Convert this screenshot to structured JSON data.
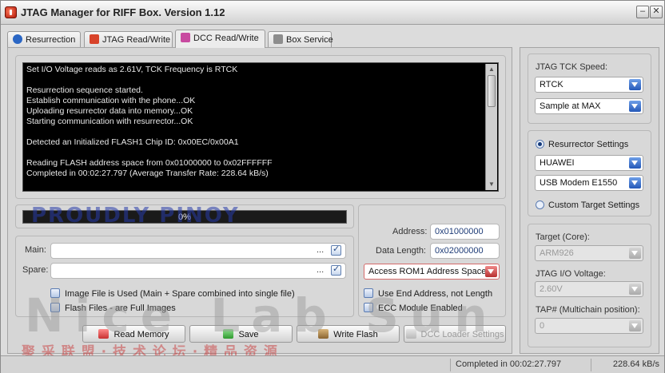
{
  "window": {
    "title": "JTAG Manager for RIFF Box. Version 1.12",
    "minimize_glyph": "–",
    "close_glyph": "✕"
  },
  "tabs": [
    {
      "label": "Resurrection",
      "icon": "info-icon",
      "color": "#2a66c4"
    },
    {
      "label": "JTAG Read/Write",
      "icon": "jtag-icon",
      "color": "#d8432a"
    },
    {
      "label": "DCC Read/Write",
      "icon": "dcc-icon",
      "color": "#c84aa0",
      "active": true
    },
    {
      "label": "Box Service",
      "icon": "box-icon",
      "color": "#8d8d8d"
    }
  ],
  "console": {
    "lines": [
      "Set I/O Voltage reads as 2.61V, TCK Frequency is RTCK",
      "",
      "Resurrection sequence started.",
      "Establish communication with the phone...OK",
      "Uploading resurrector data into memory...OK",
      "Starting communication with resurrector...OK",
      "",
      "Detected an Initialized FLASH1 Chip ID: 0x00EC/0x00A1",
      "",
      "Reading FLASH address space from 0x01000000 to 0x02FFFFFF",
      "Completed in 00:02:27.797 (Average Transfer Rate: 228.64 kB/s)"
    ]
  },
  "progress": {
    "text": "0%",
    "value": 0
  },
  "files": {
    "main_label": "Main:",
    "main_value": "",
    "main_dots": "...",
    "spare_label": "Spare:",
    "spare_value": "",
    "spare_dots": "...",
    "opt_image_file": "Image File is Used (Main + Spare combined into single file)",
    "opt_full_images": "Flash Files - are Full Images"
  },
  "address": {
    "address_label": "Address:",
    "address_value": "0x01000000",
    "length_label": "Data Length:",
    "length_value": "0x02000000",
    "access_selected": "Access ROM1 Address Space",
    "opt_end_address": "Use End Address, not Length",
    "opt_ecc": "ECC Module Enabled"
  },
  "buttons": {
    "read_memory": "Read Memory",
    "save": "Save",
    "write_flash": "Write Flash",
    "dcc_loader": "DCC Loader Settings"
  },
  "right": {
    "tck_label": "JTAG TCK Speed:",
    "tck_value": "RTCK",
    "sample_value": "Sample at MAX",
    "resurrector_settings": "Resurrector Settings",
    "manufacturer": "HUAWEI",
    "model": "USB Modem E1550",
    "custom_target": "Custom Target Settings",
    "target_label": "Target (Core):",
    "target_value": "ARM926",
    "voltage_label": "JTAG I/O Voltage:",
    "voltage_value": "2.60V",
    "tap_label": "TAP# (Multichain position):",
    "tap_value": "0"
  },
  "status": {
    "completed": "Completed in 00:02:27.797",
    "rate": "228.64 kB/s"
  },
  "watermark": {
    "line1": "PROUDLY PINOY",
    "line2": "Nice Lab Sun",
    "line3": "聚 采 联 盟 · 技 术 论 坛 · 精 品 资 源"
  }
}
